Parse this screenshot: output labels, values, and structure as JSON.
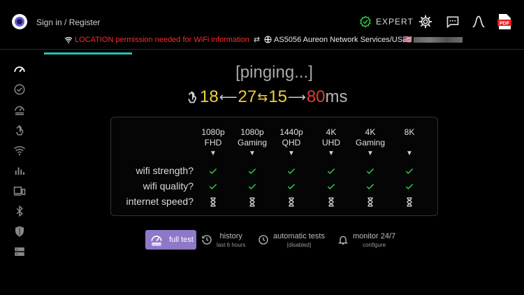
{
  "header": {
    "signin_label": "Sign in / Register",
    "expert_label": "EXPERT",
    "pdf_label": "PDF"
  },
  "status": {
    "location_warning": "LOCATION permission needed for WiFi information",
    "isp": "AS5056 Aureon Network Services/US🇺🇸"
  },
  "main": {
    "state": "[pinging...]",
    "ping": {
      "v1": "18",
      "v2": "27",
      "v3": "15",
      "v4": "80",
      "unit": "ms"
    }
  },
  "table": {
    "columns": [
      {
        "l1": "1080p",
        "l2": "FHD"
      },
      {
        "l1": "1080p",
        "l2": "Gaming"
      },
      {
        "l1": "1440p",
        "l2": "QHD"
      },
      {
        "l1": "4K",
        "l2": "UHD"
      },
      {
        "l1": "4K",
        "l2": "Gaming"
      },
      {
        "l1": "8K",
        "l2": ""
      }
    ],
    "rows": [
      {
        "label": "wifi strength?",
        "status": "check"
      },
      {
        "label": "wifi quality?",
        "status": "check"
      },
      {
        "label": "internet speed?",
        "status": "pending"
      }
    ]
  },
  "bottom": {
    "full_test": "full test",
    "history": "history",
    "history_sub": "last 6 hours",
    "auto": "automatic tests",
    "auto_sub": "[disabled]",
    "monitor": "monitor 24/7",
    "monitor_sub": "configure"
  },
  "colors": {
    "accent": "#8e78c8",
    "tab": "#24c1b5",
    "check": "#2ecc40",
    "warn": "#ff2a2a"
  }
}
